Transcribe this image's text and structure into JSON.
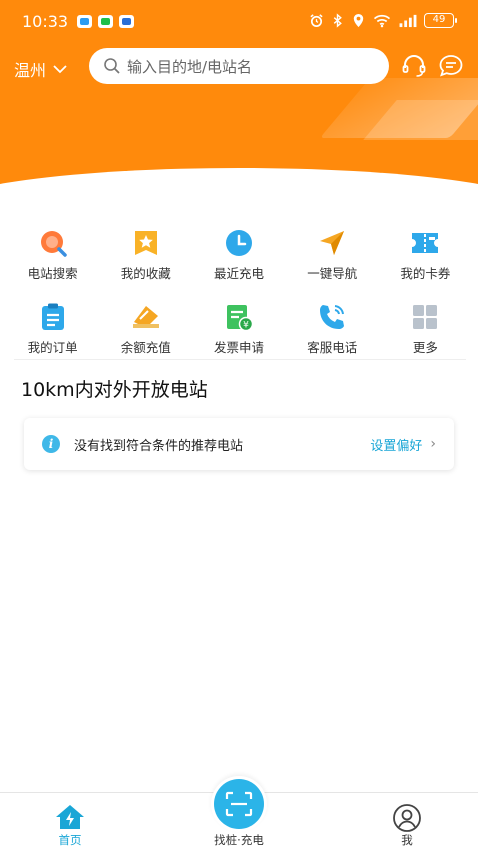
{
  "status_bar": {
    "time": "10:33",
    "battery": "49"
  },
  "header": {
    "city": "温州",
    "search_placeholder": "输入目的地/电站名"
  },
  "quick_actions": [
    {
      "label": "电站搜索",
      "icon": "station-search-icon"
    },
    {
      "label": "我的收藏",
      "icon": "star-favorite-icon"
    },
    {
      "label": "最近充电",
      "icon": "clock-icon"
    },
    {
      "label": "一键导航",
      "icon": "navigation-arrow-icon"
    },
    {
      "label": "我的卡券",
      "icon": "coupon-ticket-icon"
    },
    {
      "label": "我的订单",
      "icon": "order-clipboard-icon"
    },
    {
      "label": "余额充值",
      "icon": "card-recharge-icon"
    },
    {
      "label": "发票申请",
      "icon": "invoice-icon"
    },
    {
      "label": "客服电话",
      "icon": "phone-icon"
    },
    {
      "label": "更多",
      "icon": "grid-more-icon"
    }
  ],
  "section": {
    "title": "10km内对外开放电站"
  },
  "notice": {
    "text": "没有找到符合条件的推荐电站",
    "link": "设置偏好"
  },
  "bottom_nav": {
    "home": "首页",
    "charge": "找桩·充电",
    "me": "我"
  },
  "colors": {
    "brand_orange": "#ff8a0c",
    "accent_blue": "#1aa6d6"
  }
}
